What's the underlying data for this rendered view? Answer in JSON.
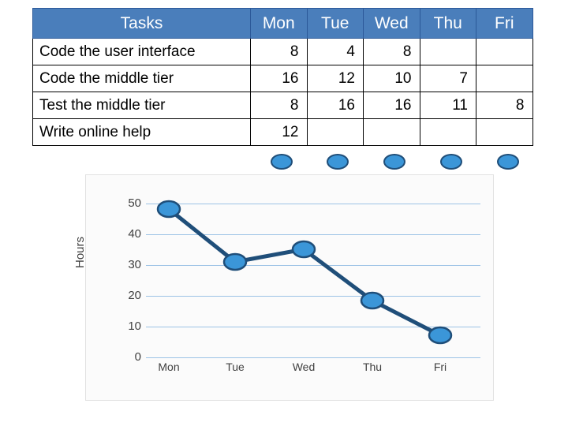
{
  "table": {
    "headers": [
      "Tasks",
      "Mon",
      "Tue",
      "Wed",
      "Thu",
      "Fri"
    ],
    "rows": [
      {
        "task": "Code the user interface",
        "values": [
          "8",
          "4",
          "8",
          "",
          ""
        ]
      },
      {
        "task": "Code the middle tier",
        "values": [
          "16",
          "12",
          "10",
          "7",
          ""
        ]
      },
      {
        "task": "Test the middle tier",
        "values": [
          "8",
          "16",
          "16",
          "11",
          "8"
        ]
      },
      {
        "task": "Write online help",
        "values": [
          "12",
          "",
          "",
          "",
          ""
        ]
      }
    ]
  },
  "chart_data": {
    "type": "line",
    "title": "",
    "xlabel": "",
    "ylabel": "Hours",
    "categories": [
      "Mon",
      "Tue",
      "Wed",
      "Thu",
      "Fri"
    ],
    "values": [
      48,
      31,
      35,
      20,
      9
    ],
    "yticks": [
      "0",
      "10",
      "20",
      "30",
      "40",
      "50"
    ],
    "ylim": [
      0,
      55
    ],
    "grid": true,
    "legend": "none",
    "series_color": "#1f4e79",
    "marker_fill": "#3b96d8",
    "marker_stroke": "#1f4e79"
  },
  "colors": {
    "header_blue": "#4a7ebb",
    "grid_blue": "#9dc3e6",
    "line_navy": "#1f4e79",
    "marker_blue": "#3b96d8"
  }
}
